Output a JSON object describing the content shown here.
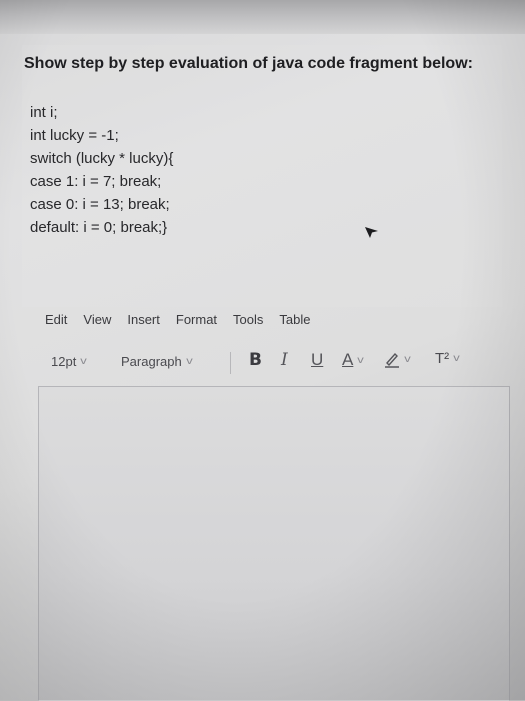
{
  "question": {
    "title": "Show step by step evaluation of java code fragment below:",
    "code_lines": [
      "int i;",
      "int lucky = -1;",
      "switch (lucky * lucky){",
      "case 1: i = 7; break;",
      "case 0: i = 13; break;",
      "default: i = 0; break;}"
    ]
  },
  "menubar": {
    "items": [
      "Edit",
      "View",
      "Insert",
      "Format",
      "Tools",
      "Table"
    ]
  },
  "toolbar": {
    "font_size": "12pt",
    "block_format": "Paragraph",
    "bold": "B",
    "italic": "I",
    "underline": "U",
    "text_color": "A",
    "highlight_icon": "pencil-highlight-icon",
    "superscript": "T²"
  },
  "editor": {
    "content": ""
  },
  "colors": {
    "page_bg": "#dedede",
    "text": "#1f1f22",
    "border": "#b5b5b9"
  }
}
